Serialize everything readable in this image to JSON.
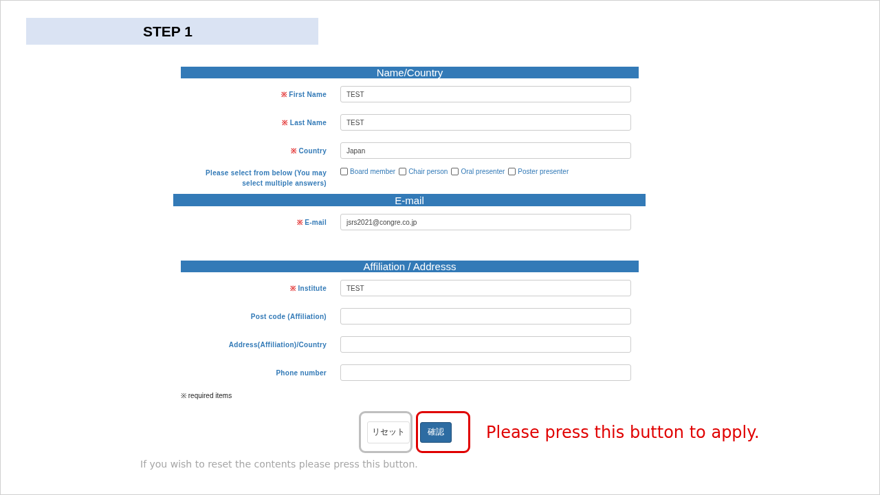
{
  "step": {
    "title": "STEP 1"
  },
  "sections": [
    {
      "title": "Name/Country",
      "wide": false,
      "fields": [
        {
          "kind": "text",
          "mark": "※",
          "label": "First Name",
          "value": "TEST"
        },
        {
          "kind": "text",
          "mark": "※",
          "label": "Last Name",
          "value": "TEST"
        },
        {
          "kind": "text",
          "mark": "※",
          "label": "Country",
          "value": "Japan"
        },
        {
          "kind": "checkboxes",
          "label": "Please select from below (You may select multiple answers)",
          "options": [
            {
              "label": "Board member",
              "checked": false
            },
            {
              "label": "Chair person",
              "checked": false
            },
            {
              "label": "Oral presenter",
              "checked": false
            },
            {
              "label": "Poster presenter",
              "checked": false
            }
          ]
        }
      ]
    },
    {
      "title": "E-mail",
      "wide": true,
      "fields": [
        {
          "kind": "text",
          "mark": "※",
          "label": "E-mail",
          "value": "jsrs2021@congre.co.jp"
        }
      ]
    },
    {
      "title": "Affiliation / Addresss",
      "wide": false,
      "fields": [
        {
          "kind": "text",
          "mark": "※",
          "label": "Institute",
          "value": "TEST"
        },
        {
          "kind": "text",
          "label": "Post code (Affiliation)"
        },
        {
          "kind": "text",
          "label": "Address(Affiliation)/Country"
        },
        {
          "kind": "text",
          "label": "Phone number"
        }
      ]
    }
  ],
  "required_note": "※ required items",
  "buttons": {
    "reset": "リセット",
    "confirm": "確認"
  },
  "callouts": {
    "confirm": "Please press this button to apply.",
    "reset": "If you wish to reset the contents please press this button."
  }
}
